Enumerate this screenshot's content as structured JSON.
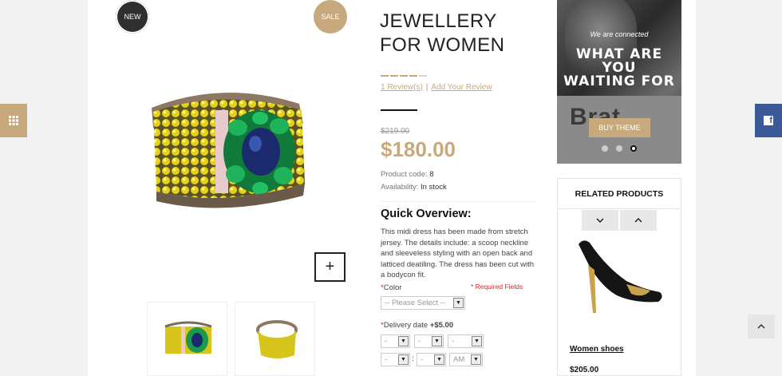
{
  "badges": {
    "new": "NEW",
    "sale": "SALE"
  },
  "product": {
    "title": "JEWELLERY FOR WOMEN",
    "rating": 4,
    "reviews_label": "1 Review(s)",
    "separator": "|",
    "add_review_label": "Add Your Review",
    "old_price": "$219.00",
    "price": "$180.00",
    "code_label": "Product code:",
    "code_value": "8",
    "availability_label": "Availability:",
    "availability_value": "In stock",
    "overview_title": "Quick Overview:",
    "overview_text": "This midi dress has been made from stretch jersey. The details include: a scoop neckline and sleeveless styling with an open back and latticed deatiling. The dress has been cut with a bodycon fit.",
    "required_note": "* Required Fields",
    "color_label": "Color",
    "color_placeholder": "-- Please Select --",
    "delivery_label": "Delivery date",
    "delivery_price": "+$5.00",
    "date_dash": "-",
    "time_colon": ":",
    "ampm": "AM",
    "zoom_symbol": "+"
  },
  "banner": {
    "tagline": "We are connected",
    "headline_1": "WHAT ARE",
    "headline_2": "YOU",
    "headline_3": "WAITING FOR",
    "shirt_text": "Brat",
    "button": "BUY THEME",
    "slides": 3,
    "active_slide": 3
  },
  "related": {
    "title": "RELATED PRODUCTS",
    "item_name": "Women shoes",
    "item_price": "$205.00"
  },
  "colors": {
    "accent": "#c8a97e",
    "dark": "#2f2f2f",
    "facebook": "#3b5998",
    "required": "#e02424"
  },
  "icons": {
    "left_widget": "grid-icon",
    "right_widget": "facebook-icon",
    "to_top": "chevron-up-icon"
  }
}
